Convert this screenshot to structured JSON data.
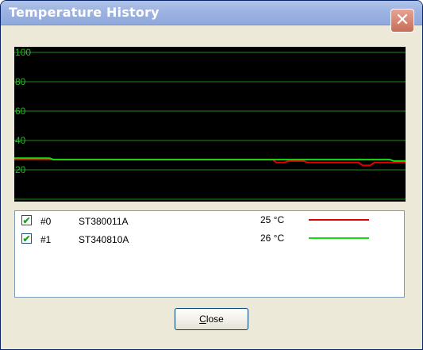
{
  "window": {
    "title": "Temperature History",
    "close_glyph": "✕"
  },
  "chart_data": {
    "type": "line",
    "ylim": [
      0,
      100
    ],
    "y_ticks": [
      "100",
      "80",
      "60",
      "40",
      "20"
    ],
    "grid": true,
    "background": "#000000",
    "grid_color": "#1f8a1f",
    "series": [
      {
        "name": "ST380011A",
        "color": "#e00000",
        "x": [
          0,
          0.1,
          0.2,
          0.3,
          0.4,
          0.5,
          0.6,
          0.66,
          0.67,
          0.69,
          0.7,
          0.74,
          0.75,
          0.82,
          0.88,
          0.89,
          0.91,
          0.92,
          0.95,
          0.96,
          1.0
        ],
        "values": [
          27,
          27,
          27,
          27,
          27,
          27,
          27,
          27,
          25,
          25,
          26,
          26,
          25,
          25,
          25,
          23,
          23,
          25,
          25,
          25,
          25
        ]
      },
      {
        "name": "ST340810A",
        "color": "#10e010",
        "x": [
          0,
          0.09,
          0.1,
          0.2,
          0.3,
          0.4,
          0.5,
          0.6,
          0.7,
          0.8,
          0.9,
          0.96,
          0.97,
          1.0
        ],
        "values": [
          28,
          28,
          27,
          27,
          27,
          27,
          27,
          27,
          27,
          27,
          27,
          27,
          26,
          26
        ]
      }
    ]
  },
  "drives": [
    {
      "checked": true,
      "check_glyph": "✔",
      "index": "#0",
      "model": "ST380011A",
      "temperature": "25 °C",
      "color": "#e00000"
    },
    {
      "checked": true,
      "check_glyph": "✔",
      "index": "#1",
      "model": "ST340810A",
      "temperature": "26 °C",
      "color": "#10e010"
    }
  ],
  "footer": {
    "close_accel": "C",
    "close_rest": "lose"
  }
}
